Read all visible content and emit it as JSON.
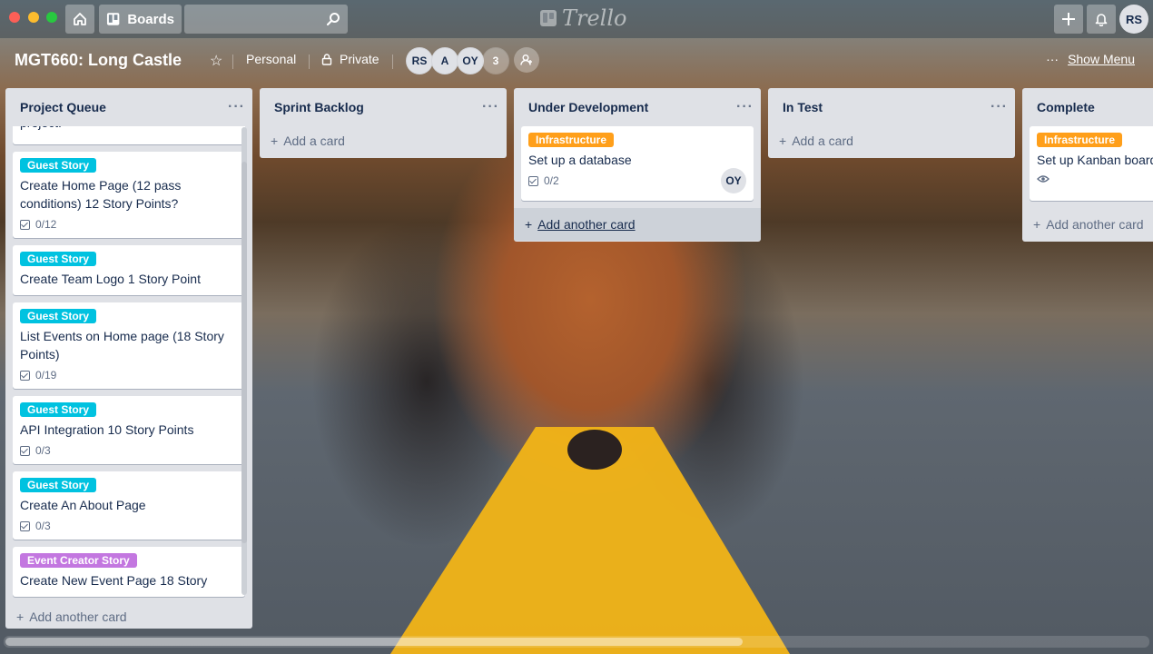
{
  "app": {
    "logo_text": "Trello"
  },
  "topbar": {
    "boards_label": "Boards",
    "search_placeholder": "",
    "avatar_initials": "RS"
  },
  "board": {
    "title": "MGT660: Long Castle",
    "team": "Personal",
    "visibility": "Private",
    "members": [
      "RS",
      "A",
      "OY"
    ],
    "member_overflow": "3",
    "show_menu": "Show Menu"
  },
  "colors": {
    "guest_story": "#00c2e0",
    "event_creator_story": "#c377e0",
    "infrastructure": "#ff9f1a"
  },
  "lists": [
    {
      "title": "Project Queue",
      "partial_card_text": "project.",
      "cards": [
        {
          "label": "Guest Story",
          "title": "Create Home Page (12 pass conditions) 12 Story Points?",
          "checklist": "0/12"
        },
        {
          "label": "Guest Story",
          "title": "Create Team Logo 1 Story Point"
        },
        {
          "label": "Guest Story",
          "title": "List Events on Home page (18 Story Points)",
          "checklist": "0/19"
        },
        {
          "label": "Guest Story",
          "title": "API Integration 10 Story Points",
          "checklist": "0/3"
        },
        {
          "label": "Guest Story",
          "title": "Create An About Page",
          "checklist": "0/3"
        },
        {
          "label": "Event Creator Story",
          "title": "Create New Event Page 18 Story"
        }
      ],
      "add_label": "Add another card"
    },
    {
      "title": "Sprint Backlog",
      "add_label": "Add a card"
    },
    {
      "title": "Under Development",
      "cards": [
        {
          "label": "Infrastructure",
          "title": "Set up a database",
          "checklist": "0/2",
          "member": "OY"
        }
      ],
      "add_label": "Add another card"
    },
    {
      "title": "In Test",
      "add_label": "Add a card"
    },
    {
      "title": "Complete",
      "cards": [
        {
          "label": "Infrastructure",
          "title": "Set up Kanban board"
        }
      ],
      "add_label": "Add another card"
    }
  ]
}
